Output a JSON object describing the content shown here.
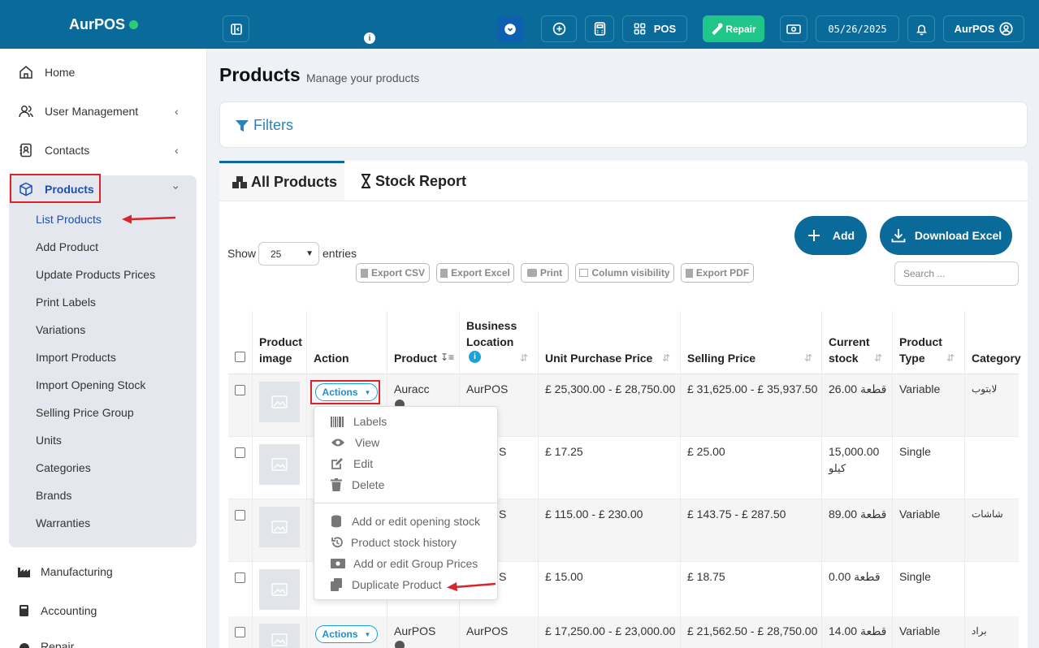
{
  "brand": {
    "name": "AurPOS",
    "status_color": "#2ecc71"
  },
  "topbar": {
    "pos_label": "POS",
    "repair_label": "Repair",
    "date": "05/26/2025",
    "user_label": "AurPOS",
    "info_glyph": "i"
  },
  "sidebar": {
    "items": [
      {
        "label": "Home",
        "icon": "home-icon"
      },
      {
        "label": "User Management",
        "icon": "users-icon"
      },
      {
        "label": "Contacts",
        "icon": "contacts-icon"
      },
      {
        "label": "Products",
        "icon": "box-icon"
      },
      {
        "label": "Manufacturing",
        "icon": "factory-icon"
      },
      {
        "label": "Accounting",
        "icon": "accounting-icon"
      },
      {
        "label": "Repair",
        "icon": "repair-icon"
      }
    ],
    "products_sub": [
      "List Products",
      "Add Product",
      "Update Products Prices",
      "Print Labels",
      "Variations",
      "Import Products",
      "Import Opening Stock",
      "Selling Price Group",
      "Units",
      "Categories",
      "Brands",
      "Warranties"
    ]
  },
  "page": {
    "title": "Products",
    "subtitle": "Manage your products"
  },
  "filters": {
    "label": "Filters"
  },
  "tabs": {
    "all_products": "All Products",
    "stock_report": "Stock Report"
  },
  "toolbar": {
    "add_label": "Add",
    "download_label": "Download Excel",
    "show_label": "Show",
    "entries_value": "25",
    "entries_label": "entries",
    "export_csv": "Export CSV",
    "export_excel": "Export Excel",
    "print": "Print",
    "column_visibility": "Column visibility",
    "export_pdf": "Export PDF",
    "search_placeholder": "Search ..."
  },
  "table": {
    "headers": {
      "image_l1": "Product",
      "image_l2": "image",
      "action": "Action",
      "product": "Product",
      "location_l1": "Business",
      "location_l2": "Location",
      "unit_purchase": "Unit Purchase Price",
      "selling": "Selling Price",
      "stock_l1": "Current",
      "stock_l2": "stock",
      "type_l1": "Product",
      "type_l2": "Type",
      "category": "Category"
    },
    "actions_label": "Actions",
    "rows": [
      {
        "product": "Auracc",
        "location": "AurPOS",
        "unit_purchase": "£ 25,300.00 - £ 28,750.00",
        "selling": "£ 31,625.00 - £ 35,937.50",
        "stock_l1": "26.00 قطعة",
        "stock_l2": "",
        "type": "Variable",
        "category": "لابتوب"
      },
      {
        "product": "",
        "location": "S",
        "unit_purchase": "£ 17.25",
        "selling": "£ 25.00",
        "stock_l1": "15,000.00",
        "stock_l2": "كيلو",
        "type": "Single",
        "category": ""
      },
      {
        "product": "",
        "location": "S",
        "unit_purchase": "£ 115.00 - £ 230.00",
        "selling": "£ 143.75 - £ 287.50",
        "stock_l1": "89.00 قطعة",
        "stock_l2": "",
        "type": "Variable",
        "category": "شاشات"
      },
      {
        "product": "",
        "location": "S",
        "unit_purchase": "£ 15.00",
        "selling": "£ 18.75",
        "stock_l1": "0.00 قطعة",
        "stock_l2": "",
        "type": "Single",
        "category": ""
      },
      {
        "product": "AurPOS",
        "location": "AurPOS",
        "unit_purchase": "£ 17,250.00 - £ 23,000.00",
        "selling": "£ 21,562.50 - £ 28,750.00",
        "stock_l1": "14.00 قطعة",
        "stock_l2": "",
        "type": "Variable",
        "category": "براد"
      }
    ]
  },
  "dropdown": {
    "items": [
      "Labels",
      "View",
      "Edit",
      "Delete",
      "Add or edit opening stock",
      "Product stock history",
      "Add or edit Group Prices",
      "Duplicate Product"
    ]
  },
  "colors": {
    "primary": "#0a6b9a",
    "repair": "#20c58a",
    "annotation": "#d9242b",
    "link": "#1a8ed0"
  }
}
